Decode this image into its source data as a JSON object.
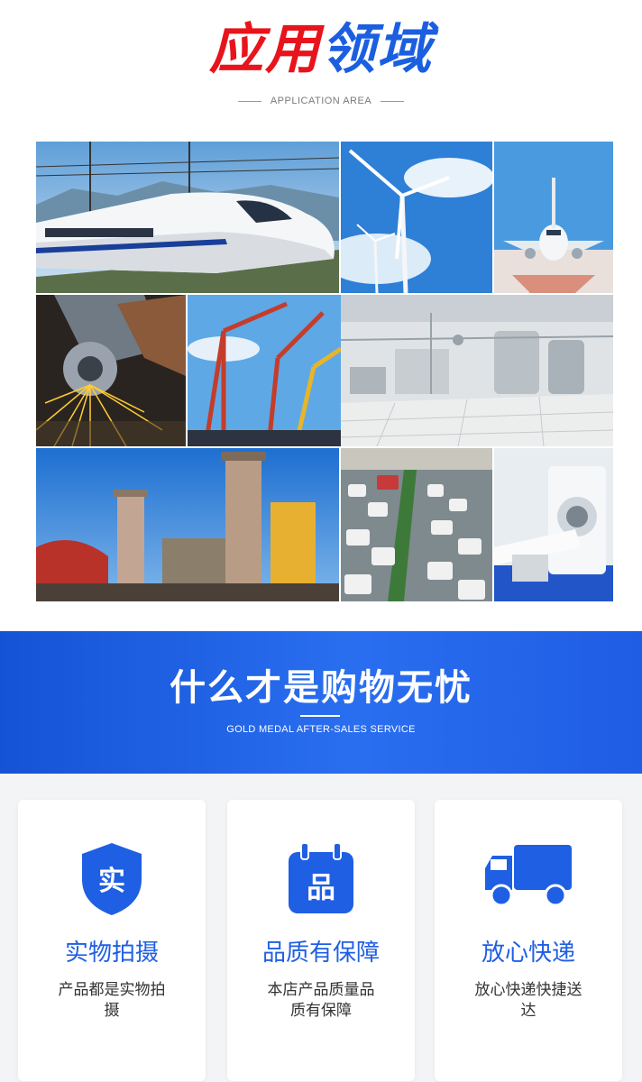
{
  "header": {
    "title_part1": "应用",
    "title_part2": "领域",
    "subtitle": "APPLICATION AREA"
  },
  "band": {
    "title": "什么才是购物无忧",
    "subtitle": "GOLD MEDAL AFTER-SALES SERVICE"
  },
  "cards": [
    {
      "icon": "shield-icon",
      "icon_text": "实",
      "title": "实物拍摄",
      "desc": "产品都是实物拍摄"
    },
    {
      "icon": "calendar-icon",
      "icon_text": "品",
      "title": "品质有保障",
      "desc": "本店产品质量品质有保障"
    },
    {
      "icon": "truck-icon",
      "title": "放心快递",
      "desc": "放心快递快捷送达"
    }
  ],
  "colors": {
    "accent_red": "#e8141c",
    "accent_blue": "#1b5fe0",
    "band_blue": "#1553d6"
  }
}
